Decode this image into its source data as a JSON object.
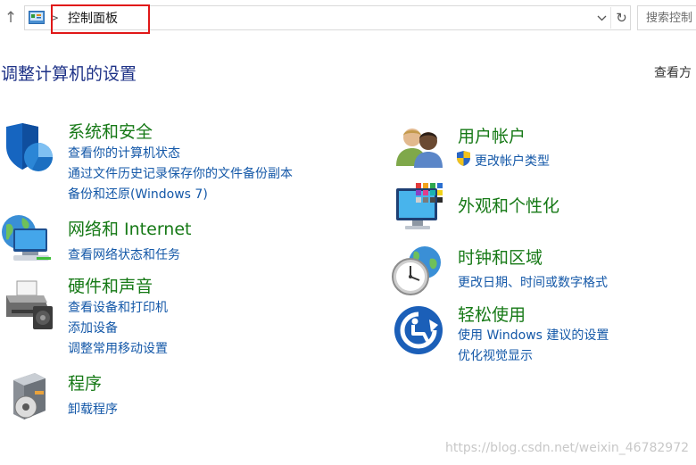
{
  "address_bar": {
    "breadcrumb": "控制面板",
    "search_placeholder": "搜索控制"
  },
  "header": {
    "title": "调整计算机的设置",
    "view_by": "查看方"
  },
  "categories": {
    "system_security": {
      "title": "系统和安全",
      "links": [
        "查看你的计算机状态",
        "通过文件历史记录保存你的文件备份副本",
        "备份和还原(Windows 7)"
      ]
    },
    "network": {
      "title": "网络和 Internet",
      "links": [
        "查看网络状态和任务"
      ]
    },
    "hardware": {
      "title": "硬件和声音",
      "links": [
        "查看设备和打印机",
        "添加设备",
        "调整常用移动设置"
      ]
    },
    "programs": {
      "title": "程序",
      "links": [
        "卸载程序"
      ]
    },
    "user_accounts": {
      "title": "用户帐户",
      "links": [
        "更改帐户类型"
      ]
    },
    "appearance": {
      "title": "外观和个性化",
      "links": []
    },
    "clock_region": {
      "title": "时钟和区域",
      "links": [
        "更改日期、时间或数字格式"
      ]
    },
    "ease_of_access": {
      "title": "轻松使用",
      "links": [
        "使用 Windows 建议的设置",
        "优化视觉显示"
      ]
    }
  },
  "watermark": "https://blog.csdn.net/weixin_46782972",
  "icons": {
    "up": "up-arrow-icon",
    "address": "control-panel-icon",
    "dropdown": "chevron-down-icon",
    "refresh": "refresh-icon",
    "system_security": "shield-icon",
    "network": "network-globe-icon",
    "hardware": "printer-icon",
    "programs": "programs-disc-icon",
    "user_accounts": "users-icon",
    "uac": "uac-shield-icon",
    "appearance": "monitor-icon",
    "clock_region": "clock-globe-icon",
    "ease_of_access": "ease-of-access-icon"
  },
  "colors": {
    "category_title": "#167916",
    "link": "#1458a8",
    "page_title": "#1e3287",
    "highlight_box": "#e01818"
  }
}
